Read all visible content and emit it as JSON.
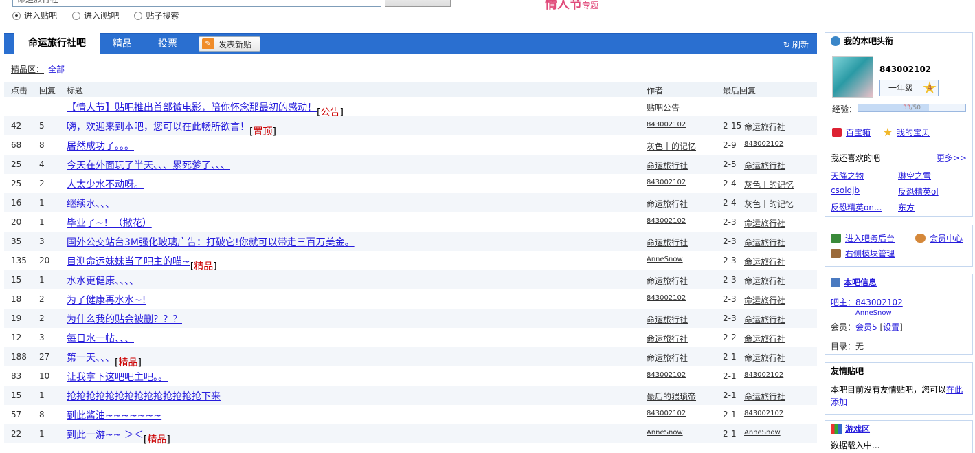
{
  "search": {
    "value": "命运旅行社"
  },
  "promo": {
    "text": "情人节",
    "sub": "专题"
  },
  "radios": [
    {
      "label": "进入贴吧",
      "checked": true
    },
    {
      "label": "进入i贴吧",
      "checked": false
    },
    {
      "label": "贴子搜索",
      "checked": false
    }
  ],
  "tabs": {
    "active": "命运旅行社吧",
    "jingpin": "精品",
    "toupiao": "投票",
    "post": "发表新贴",
    "refresh": "刷新"
  },
  "crumb": {
    "label": "精品区：",
    "all": "全部"
  },
  "columns": {
    "click": "点击",
    "reply": "回复",
    "title": "标题",
    "author": "作者",
    "last": "最后回复"
  },
  "rows": [
    {
      "click": "--",
      "reply": "--",
      "title": "【情人节】贴吧推出首部微电影，陪你怀念那最初的感动！",
      "tag": "公告",
      "author": "贴吧公告",
      "date": "----",
      "last": ""
    },
    {
      "click": "42",
      "reply": "5",
      "title": "嗨，欢迎来到本吧，您可以在此畅所欲言！",
      "tag": "置顶",
      "author": "843002102",
      "date": "2-15",
      "last": "命运旅行社"
    },
    {
      "click": "68",
      "reply": "8",
      "title": "居然成功了。。。",
      "tag": "",
      "author": "灰色丨的记忆",
      "date": "2-9",
      "last": "843002102"
    },
    {
      "click": "25",
      "reply": "4",
      "title": "今天在外面玩了半天、、、累死爹了、、、",
      "tag": "",
      "author": "命运旅行社",
      "date": "2-5",
      "last": "命运旅行社"
    },
    {
      "click": "25",
      "reply": "2",
      "title": "人太少水不动呀。",
      "tag": "",
      "author": "843002102",
      "date": "2-4",
      "last": "灰色丨的记忆"
    },
    {
      "click": "16",
      "reply": "1",
      "title": "继续水、、、",
      "tag": "",
      "author": "命运旅行社",
      "date": "2-4",
      "last": "灰色丨的记忆"
    },
    {
      "click": "20",
      "reply": "1",
      "title": "毕业了~！（撒花）",
      "tag": "",
      "author": "843002102",
      "date": "2-3",
      "last": "命运旅行社"
    },
    {
      "click": "35",
      "reply": "3",
      "title": "国外公交站台3M强化玻璃广告：打破它!你就可以带走三百万美金。",
      "tag": "",
      "author": "命运旅行社",
      "date": "2-3",
      "last": "命运旅行社"
    },
    {
      "click": "135",
      "reply": "20",
      "title": "目测命运妹妹当了吧主的喵~",
      "tag": "精品",
      "author": "AnneSnow",
      "date": "2-3",
      "last": "命运旅行社"
    },
    {
      "click": "15",
      "reply": "1",
      "title": "水水更健康、、、、",
      "tag": "",
      "author": "命运旅行社",
      "date": "2-3",
      "last": "命运旅行社"
    },
    {
      "click": "18",
      "reply": "2",
      "title": "为了健康再水水~!",
      "tag": "",
      "author": "843002102",
      "date": "2-3",
      "last": "命运旅行社"
    },
    {
      "click": "19",
      "reply": "2",
      "title": "为什么我的贴会被删？？？",
      "tag": "",
      "author": "命运旅行社",
      "date": "2-3",
      "last": "命运旅行社"
    },
    {
      "click": "12",
      "reply": "3",
      "title": "每日水一帖、、、",
      "tag": "",
      "author": "命运旅行社",
      "date": "2-2",
      "last": "命运旅行社"
    },
    {
      "click": "188",
      "reply": "27",
      "title": "第一天、、、",
      "tag": "精品",
      "author": "命运旅行社",
      "date": "2-1",
      "last": "命运旅行社"
    },
    {
      "click": "83",
      "reply": "10",
      "title": "让我拿下这吧吧主吧。。",
      "tag": "",
      "author": "843002102",
      "date": "2-1",
      "last": "843002102"
    },
    {
      "click": "15",
      "reply": "1",
      "title": "抢抢抢抢抢抢抢抢抢抢抢抢抢抢下来",
      "tag": "",
      "author": "最后的猥琐帝",
      "date": "2-1",
      "last": "命运旅行社"
    },
    {
      "click": "57",
      "reply": "8",
      "title": "到此酱油~~~~~~~",
      "tag": "",
      "author": "843002102",
      "date": "2-1",
      "last": "843002102"
    },
    {
      "click": "22",
      "reply": "1",
      "title": "到此一游~~ ＞＜",
      "tag": "精品",
      "author": "AnneSnow",
      "date": "2-1",
      "last": "AnneSnow"
    }
  ],
  "user": {
    "title": "我的本吧头衔",
    "name": "843002102",
    "grade": "一年级",
    "level": "4",
    "exp_label": "经验：",
    "exp_cur": "33",
    "exp_max": "/50",
    "exp_fraction": 0.66
  },
  "tools": {
    "box": "百宝箱",
    "treasure": "我的宝贝"
  },
  "likes": {
    "title": "我还喜欢的吧",
    "more": "更多>>",
    "items": [
      "天降之物",
      "琳空之雪",
      "csoldjb",
      "反恐精英ol",
      "反恐精英on...",
      "东方"
    ]
  },
  "admin": {
    "backend": "进入吧务后台",
    "member": "会员中心",
    "module": "右侧模块管理"
  },
  "info": {
    "title": "本吧信息",
    "owner_label": "吧主：",
    "owner1": "843002102",
    "owner2": "AnneSnow",
    "member_label": "会员：",
    "member_val": "会员5",
    "settings": "设置",
    "dir_label": "目录：无"
  },
  "friends": {
    "title": "友情贴吧",
    "text": "本吧目前没有友情贴吧，您可以",
    "link": "在此添加"
  },
  "games": {
    "title": "游戏区",
    "loading": "数据载入中..."
  }
}
